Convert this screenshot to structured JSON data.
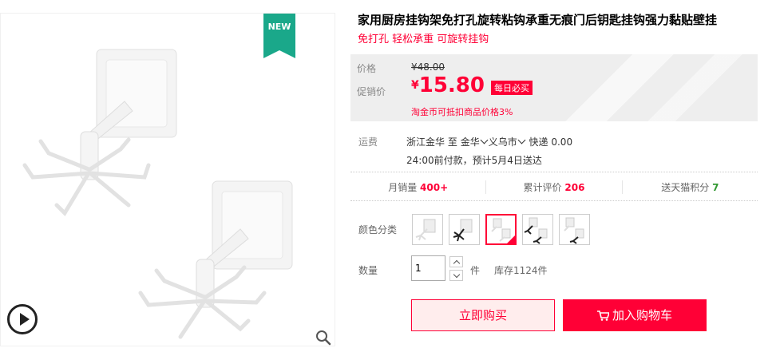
{
  "gallery": {
    "badge": "NEW"
  },
  "product": {
    "title": "家用厨房挂钩架免打孔旋转粘钩承重无痕门后钥匙挂钩强力黏贴壁挂",
    "subtitle": "免打孔 轻松承重 可旋转挂钩"
  },
  "price": {
    "price_label": "价格",
    "original": "¥48.00",
    "promo_label": "促销价",
    "yen": "¥",
    "promo_value": "15.80",
    "promo_tag": "每日必买",
    "coin_note": "淘金币可抵扣商品价格3%"
  },
  "shipping": {
    "label": "运费",
    "from": "浙江金华",
    "to_word": "至",
    "to_city": "金华",
    "to_district": "义乌市",
    "method": "快递 0.00",
    "delivery": "24:00前付款，预计5月4日送达"
  },
  "stats": {
    "monthly_sales_label": "月销量",
    "monthly_sales": "400+",
    "reviews_label": "累计评价",
    "reviews": "206",
    "points_label": "送天猫积分",
    "points": "7"
  },
  "sku": {
    "color_label": "颜色分类",
    "selected_index": 2
  },
  "quantity": {
    "label": "数量",
    "value": "1",
    "unit": "件",
    "stock": "库存1124件"
  },
  "actions": {
    "buy_now": "立即购买",
    "add_cart": "加入购物车"
  },
  "colors": {
    "accent": "#ff0036",
    "badge_green": "#1aa88a",
    "points_green": "#339933"
  }
}
